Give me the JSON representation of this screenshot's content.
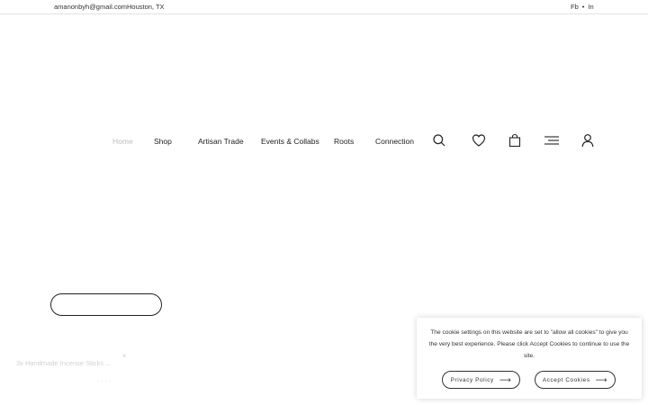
{
  "topbar": {
    "email": "amanonbyh@gmail.com",
    "location": "Houston, TX",
    "social": [
      "Fb",
      "In"
    ],
    "separator": "•"
  },
  "nav": {
    "items": [
      {
        "label": "Home",
        "active": true
      },
      {
        "label": "Shop",
        "active": false
      },
      {
        "label": "Artisan Trade",
        "active": false
      },
      {
        "label": "Events & Collabs",
        "active": false
      },
      {
        "label": "Roots",
        "active": false
      },
      {
        "label": "Connection",
        "active": false
      }
    ],
    "icons": [
      "search-icon",
      "heart-icon",
      "shopping-bag-icon",
      "menu-icon",
      "user-icon"
    ]
  },
  "notification": {
    "title": "3x Handmade Incense Sticks ...",
    "close": "×",
    "dots": "· · · ·"
  },
  "cookie": {
    "text": "The cookie settings on this website are set to \"allow all cookies\" to give you the very best experience. Please click Accept Cookies to continue to use the site.",
    "privacy_label": "Privacy Policy",
    "accept_label": "Accept Cookies",
    "arrow": "⟶"
  }
}
